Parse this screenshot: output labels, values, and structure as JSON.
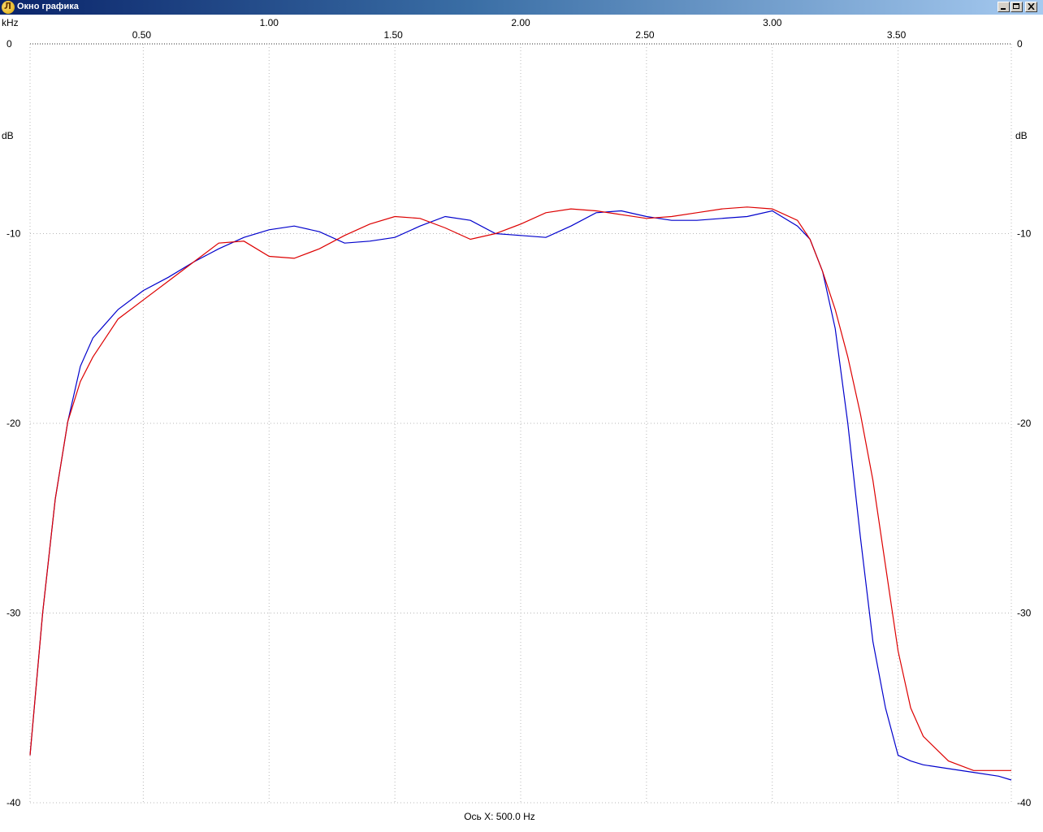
{
  "window": {
    "title": "Окно графика",
    "app_icon": "plot-app-icon",
    "controls": [
      "minimize-icon",
      "maximize-icon",
      "close-icon"
    ]
  },
  "chart_data": {
    "type": "line",
    "x_unit": "kHz",
    "y_unit": "dB",
    "xlabel": "Ось X: 500.0 Hz",
    "xlim": [
      0.05,
      3.95
    ],
    "ylim": [
      -40,
      0
    ],
    "x_ticks_top": [
      "1.00",
      "2.00",
      "3.00"
    ],
    "x_ticks_bottom": [
      "0.50",
      "1.50",
      "2.50",
      "3.50"
    ],
    "x_tick_values_top": [
      1.0,
      2.0,
      3.0
    ],
    "x_tick_values_bottom": [
      0.5,
      1.5,
      2.5,
      3.5
    ],
    "y_ticks": [
      "0",
      "-10",
      "-20",
      "-30",
      "-40"
    ],
    "y_tick_values": [
      0,
      -10,
      -20,
      -30,
      -40
    ],
    "grid": true,
    "series": [
      {
        "color": "#0000cc",
        "x": [
          0.05,
          0.1,
          0.15,
          0.2,
          0.25,
          0.3,
          0.4,
          0.5,
          0.6,
          0.7,
          0.8,
          0.9,
          1.0,
          1.1,
          1.2,
          1.3,
          1.4,
          1.5,
          1.6,
          1.7,
          1.8,
          1.9,
          2.0,
          2.1,
          2.2,
          2.3,
          2.4,
          2.5,
          2.6,
          2.7,
          2.8,
          2.9,
          3.0,
          3.1,
          3.15,
          3.2,
          3.25,
          3.3,
          3.35,
          3.4,
          3.45,
          3.5,
          3.55,
          3.6,
          3.7,
          3.8,
          3.9,
          3.95
        ],
        "y": [
          -37.5,
          -30,
          -24,
          -19.9,
          -17,
          -15.5,
          -14,
          -13,
          -12.3,
          -11.5,
          -10.8,
          -10.2,
          -9.8,
          -9.6,
          -9.9,
          -10.5,
          -10.4,
          -10.2,
          -9.6,
          -9.1,
          -9.3,
          -10,
          -10.1,
          -10.2,
          -9.6,
          -8.9,
          -8.8,
          -9.1,
          -9.3,
          -9.3,
          -9.2,
          -9.1,
          -8.8,
          -9.6,
          -10.3,
          -12,
          -15,
          -20,
          -26,
          -31.5,
          -35,
          -37.5,
          -37.8,
          -38,
          -38.2,
          -38.4,
          -38.6,
          -38.8
        ]
      },
      {
        "color": "#dd0000",
        "x": [
          0.05,
          0.1,
          0.15,
          0.2,
          0.25,
          0.3,
          0.4,
          0.5,
          0.6,
          0.7,
          0.8,
          0.9,
          1.0,
          1.1,
          1.2,
          1.3,
          1.4,
          1.5,
          1.6,
          1.7,
          1.8,
          1.9,
          2.0,
          2.1,
          2.2,
          2.3,
          2.4,
          2.5,
          2.6,
          2.7,
          2.8,
          2.9,
          3.0,
          3.1,
          3.15,
          3.2,
          3.25,
          3.3,
          3.35,
          3.4,
          3.45,
          3.5,
          3.55,
          3.6,
          3.7,
          3.8,
          3.9,
          3.95
        ],
        "y": [
          -37.5,
          -30,
          -24,
          -19.9,
          -17.8,
          -16.5,
          -14.5,
          -13.5,
          -12.5,
          -11.5,
          -10.5,
          -10.4,
          -11.2,
          -11.3,
          -10.8,
          -10.1,
          -9.5,
          -9.1,
          -9.2,
          -9.7,
          -10.3,
          -10,
          -9.5,
          -8.9,
          -8.7,
          -8.8,
          -9,
          -9.2,
          -9.1,
          -8.9,
          -8.7,
          -8.6,
          -8.7,
          -9.3,
          -10.3,
          -12,
          -14,
          -16.5,
          -19.5,
          -23,
          -27.5,
          -32,
          -35,
          -36.5,
          -37.8,
          -38.3,
          -38.3,
          -38.3
        ]
      }
    ]
  }
}
